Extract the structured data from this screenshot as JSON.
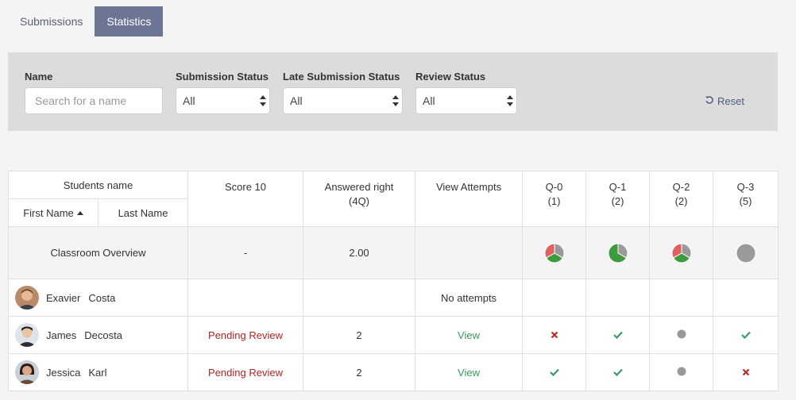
{
  "tabs": [
    {
      "label": "Submissions",
      "active": false
    },
    {
      "label": "Statistics",
      "active": true
    }
  ],
  "filters": {
    "name_label": "Name",
    "name_placeholder": "Search for a name",
    "name_value": "",
    "submission_label": "Submission Status",
    "submission_value": "All",
    "late_label": "Late Submission Status",
    "late_value": "All",
    "review_label": "Review Status",
    "review_value": "All",
    "reset_label": "Reset",
    "reset_icon": "undo-icon"
  },
  "table": {
    "headers": {
      "students_name": "Students name",
      "first_name": "First Name",
      "last_name": "Last Name",
      "score": "Score 10",
      "answered_line1": "Answered right",
      "answered_line2": "(4Q)",
      "view_attempts": "View Attempts",
      "questions": [
        {
          "label": "Q-0",
          "points": "(1)"
        },
        {
          "label": "Q-1",
          "points": "(2)"
        },
        {
          "label": "Q-2",
          "points": "(2)"
        },
        {
          "label": "Q-3",
          "points": "(5)"
        }
      ]
    },
    "overview": {
      "label": "Classroom Overview",
      "score": "-",
      "answered": "2.00",
      "pies": [
        {
          "correct": 0.333,
          "incorrect": 0.333,
          "pending": 0.334
        },
        {
          "correct": 0.667,
          "incorrect": 0,
          "pending": 0.333
        },
        {
          "correct": 0.333,
          "incorrect": 0.333,
          "pending": 0.334
        },
        {
          "correct": 0,
          "incorrect": 0,
          "pending": 1
        }
      ]
    },
    "students": [
      {
        "first": "Exavier",
        "last": "Costa",
        "score": "",
        "answered": "",
        "attempts": "No attempts",
        "results": [
          "",
          "",
          "",
          ""
        ]
      },
      {
        "first": "James",
        "last": "Decosta",
        "score": "Pending Review",
        "answered": "2",
        "attempts": "View",
        "results": [
          "wrong",
          "right",
          "pending",
          "right"
        ]
      },
      {
        "first": "Jessica",
        "last": "Karl",
        "score": "Pending Review",
        "answered": "2",
        "attempts": "View",
        "results": [
          "right",
          "right",
          "pending",
          "wrong"
        ]
      }
    ]
  },
  "colors": {
    "correct": "#3d9b3d",
    "incorrect": "#e06060",
    "pending": "#9a9a9a",
    "check": "#3a9a6a",
    "cross": "#c02a2a",
    "accent": "#6c7694"
  }
}
